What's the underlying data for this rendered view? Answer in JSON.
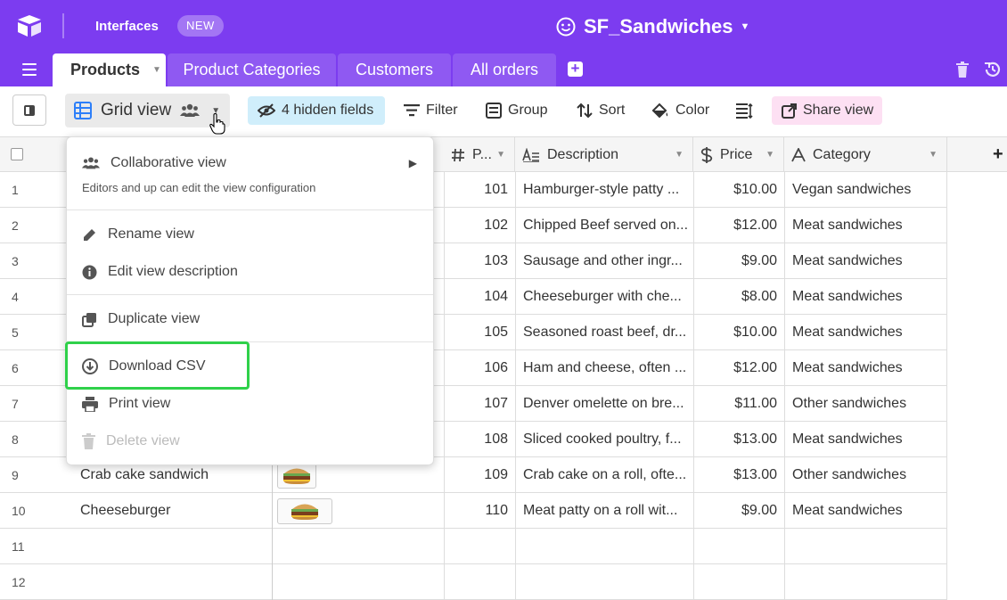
{
  "header": {
    "interfaces_label": "Interfaces",
    "new_badge": "NEW",
    "base_name": "SF_Sandwiches"
  },
  "tabs": [
    {
      "label": "Products",
      "active": true
    },
    {
      "label": "Product Categories"
    },
    {
      "label": "Customers"
    },
    {
      "label": "All orders"
    }
  ],
  "toolbar": {
    "view_name": "Grid view",
    "hidden_fields": "4 hidden fields",
    "filter": "Filter",
    "group": "Group",
    "sort": "Sort",
    "color": "Color",
    "share_view": "Share view"
  },
  "columns": {
    "id": "P...",
    "description": "Description",
    "price": "Price",
    "category": "Category"
  },
  "rows": [
    {
      "num": "1",
      "name": "",
      "id": "101",
      "description": "Hamburger-style patty ...",
      "price": "$10.00",
      "category": "Vegan sandwiches"
    },
    {
      "num": "2",
      "name": "",
      "id": "102",
      "description": "Chipped Beef served on...",
      "price": "$12.00",
      "category": "Meat sandwiches"
    },
    {
      "num": "3",
      "name": "",
      "id": "103",
      "description": "Sausage and other ingr...",
      "price": "$9.00",
      "category": "Meat sandwiches"
    },
    {
      "num": "4",
      "name": "",
      "id": "104",
      "description": "Cheeseburger with che...",
      "price": "$8.00",
      "category": "Meat sandwiches"
    },
    {
      "num": "5",
      "name": "",
      "id": "105",
      "description": "Seasoned roast beef, dr...",
      "price": "$10.00",
      "category": "Meat sandwiches"
    },
    {
      "num": "6",
      "name": "",
      "id": "106",
      "description": "Ham and cheese, often ...",
      "price": "$12.00",
      "category": "Meat sandwiches"
    },
    {
      "num": "7",
      "name": "",
      "id": "107",
      "description": "Denver omelette on bre...",
      "price": "$11.00",
      "category": "Other sandwiches"
    },
    {
      "num": "8",
      "name": "",
      "id": "108",
      "description": "Sliced cooked poultry, f...",
      "price": "$13.00",
      "category": "Meat sandwiches"
    },
    {
      "num": "9",
      "name": "Crab cake sandwich",
      "id": "109",
      "description": "Crab cake on a roll, ofte...",
      "price": "$13.00",
      "category": "Other sandwiches"
    },
    {
      "num": "10",
      "name": "Cheeseburger",
      "id": "110",
      "description": "Meat patty on a roll wit...",
      "price": "$9.00",
      "category": "Meat sandwiches"
    },
    {
      "num": "11",
      "name": "",
      "id": "",
      "description": "",
      "price": "",
      "category": ""
    },
    {
      "num": "12",
      "name": "",
      "id": "",
      "description": "",
      "price": "",
      "category": ""
    }
  ],
  "menu": {
    "collaborative_view": "Collaborative view",
    "collaborative_note": "Editors and up can edit the view configuration",
    "rename_view": "Rename view",
    "edit_description": "Edit view description",
    "duplicate_view": "Duplicate view",
    "download_csv": "Download CSV",
    "print_view": "Print view",
    "delete_view": "Delete view"
  },
  "colors": {
    "brand_purple": "#7c3cf0",
    "hidden_fields_bg": "#d0eefb",
    "share_view_bg": "#fde0f3",
    "highlight_green": "#2fd14a"
  }
}
